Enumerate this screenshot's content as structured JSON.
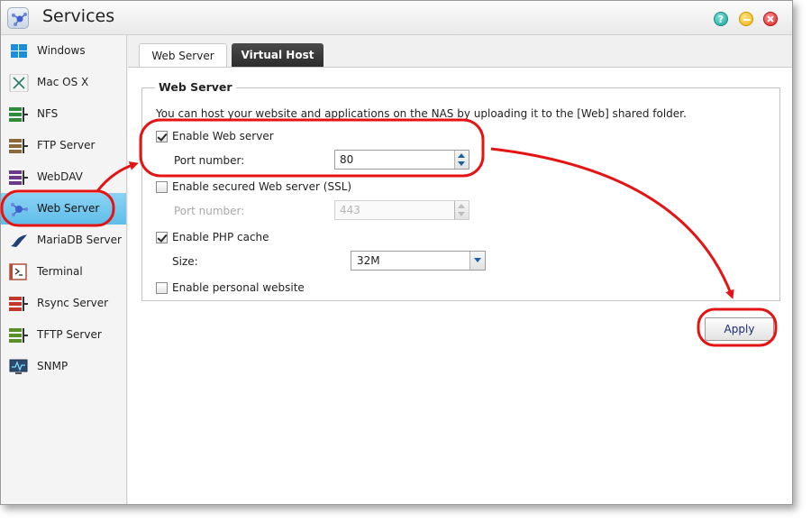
{
  "window": {
    "title": "Services",
    "icons": {
      "app": "services-icon",
      "help": "help-icon",
      "minimize": "minimize-icon",
      "close": "close-icon"
    },
    "help_glyph": "?"
  },
  "sidebar": {
    "active_index": 5,
    "items": [
      {
        "label": "Windows",
        "icon": "windows-icon"
      },
      {
        "label": "Mac OS X",
        "icon": "mac-os-x-icon"
      },
      {
        "label": "NFS",
        "icon": "nfs-icon"
      },
      {
        "label": "FTP Server",
        "icon": "ftp-server-icon"
      },
      {
        "label": "WebDAV",
        "icon": "webdav-icon"
      },
      {
        "label": "Web Server",
        "icon": "web-server-icon"
      },
      {
        "label": "MariaDB Server",
        "icon": "mariadb-server-icon"
      },
      {
        "label": "Terminal",
        "icon": "terminal-icon"
      },
      {
        "label": "Rsync Server",
        "icon": "rsync-server-icon"
      },
      {
        "label": "TFTP Server",
        "icon": "tftp-server-icon"
      },
      {
        "label": "SNMP",
        "icon": "snmp-icon"
      }
    ]
  },
  "tabs": {
    "active": "Web Server",
    "items": [
      "Web Server",
      "Virtual Host"
    ]
  },
  "web_server": {
    "group_title": "Web Server",
    "description": "You can host your website and applications on the NAS by uploading it to the [Web] shared folder.",
    "enable_web_server": {
      "label": "Enable Web server",
      "checked": true
    },
    "port": {
      "label": "Port number:",
      "value": "80"
    },
    "enable_ssl": {
      "label": "Enable secured Web server (SSL)",
      "checked": false
    },
    "ssl_port": {
      "label": "Port number:",
      "value": "443",
      "disabled": true
    },
    "enable_php_cache": {
      "label": "Enable PHP cache",
      "checked": true
    },
    "cache_size": {
      "label": "Size:",
      "value": "32M"
    },
    "enable_personal_website": {
      "label": "Enable personal website",
      "checked": false
    }
  },
  "actions": {
    "apply_label": "Apply"
  },
  "colors": {
    "sidebar_active": "#6cc6ee",
    "annotation": "#e41414",
    "tab_dark": "#2f2f2f",
    "spin_arrow": "#1c5fa8"
  }
}
